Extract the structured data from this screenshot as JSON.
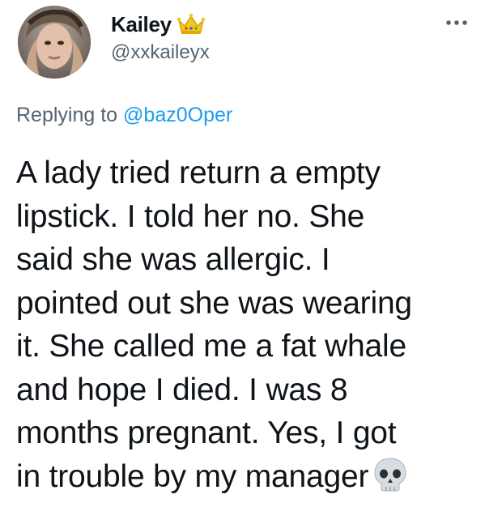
{
  "author": {
    "display_name": "Kailey",
    "handle": "@xxkaileyx",
    "badge_emoji": "crown-icon"
  },
  "reply": {
    "prefix": "Replying to",
    "mention": "@baz0Oper"
  },
  "tweet": {
    "lines": [
      "A lady tried return a empty",
      "lipstick. I told her no. She",
      "said she was allergic. I",
      "pointed out she was wearing",
      "it. She called me a fat whale",
      "and hope I died. I was 8",
      "months pregnant. Yes, I got",
      "in trouble by my manager"
    ],
    "trailing_emoji": "skull-icon"
  },
  "colors": {
    "text_primary": "#0f1419",
    "text_secondary": "#536471",
    "link": "#1d9bf0",
    "background": "#ffffff"
  }
}
